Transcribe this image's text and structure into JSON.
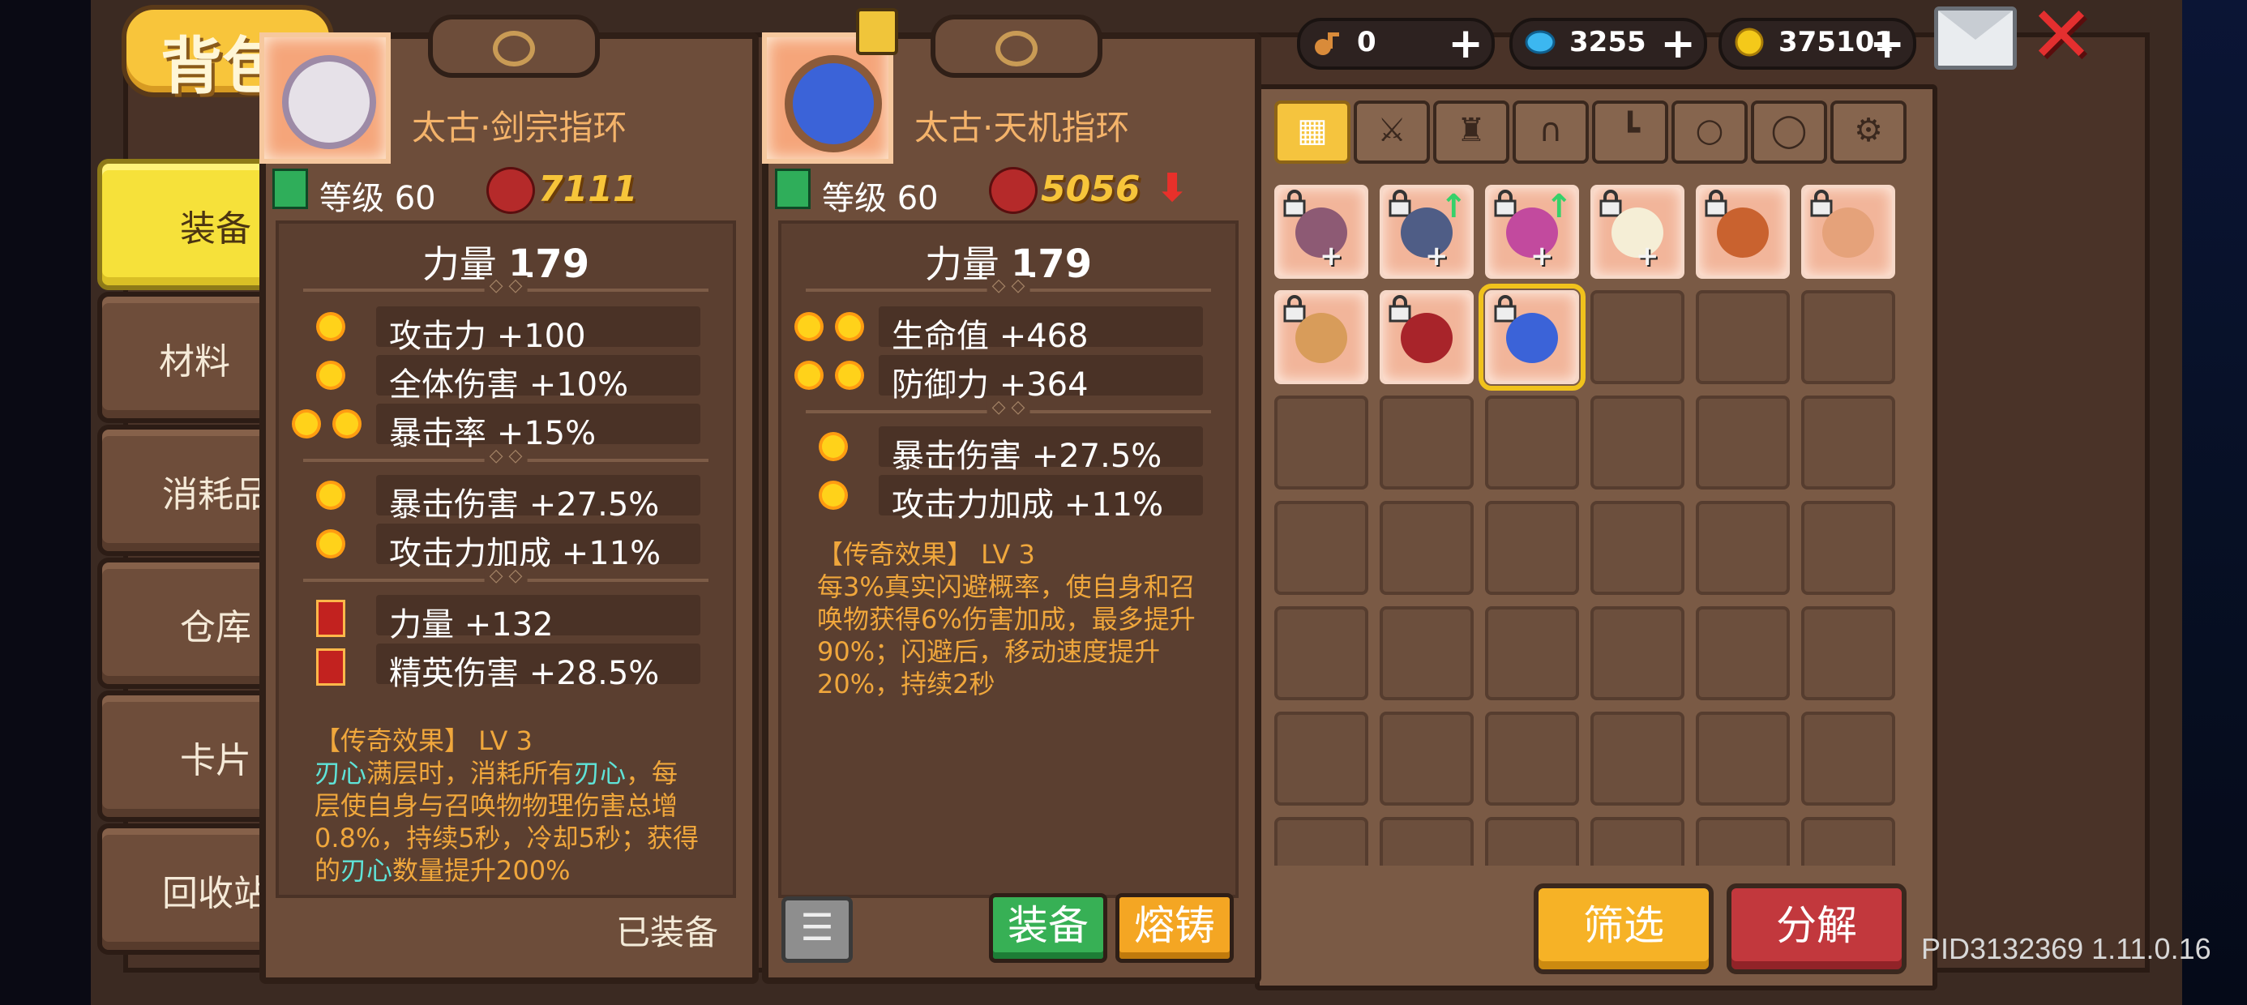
{
  "window": {
    "title": "背包",
    "close_icon": "close-x-icon",
    "mail_icon": "mail-icon"
  },
  "currencies": [
    {
      "icon": "key-icon",
      "value": "0",
      "color": "#d98b3a"
    },
    {
      "icon": "gem-icon",
      "value": "3255",
      "color": "#3cb7f0"
    },
    {
      "icon": "coin-icon",
      "value": "375101",
      "color": "#f4c91a"
    }
  ],
  "sidebar": {
    "items": [
      {
        "label": "装备",
        "active": true
      },
      {
        "label": "材料",
        "active": false
      },
      {
        "label": "消耗品",
        "active": false
      },
      {
        "label": "仓库",
        "active": false
      },
      {
        "label": "卡片",
        "active": false
      },
      {
        "label": "回收站",
        "active": false
      }
    ]
  },
  "card_left": {
    "name": "太古·剑宗指环",
    "level": "等级 60",
    "power": "7111",
    "main_stat_label": "力量",
    "main_stat_value": "179",
    "stats_a": [
      {
        "suns": 1,
        "text": "攻击力 +100"
      },
      {
        "suns": 1,
        "text": "全体伤害 +10%"
      },
      {
        "suns": 2,
        "text": "暴击率 +15%"
      }
    ],
    "stats_b": [
      {
        "suns": 1,
        "text": "暴击伤害 +27.5%"
      },
      {
        "suns": 1,
        "text": "攻击力加成 +11%"
      }
    ],
    "stats_c": [
      {
        "text": "力量 +132"
      },
      {
        "text": "精英伤害 +28.5%"
      }
    ],
    "legend_title": "【传奇效果】 LV 3",
    "legend_lines": [
      {
        "hl": "刃心",
        "rest": "满层时，消耗所有"
      },
      {
        "hl2": "刃心",
        "rest2": "，每"
      },
      {
        "line": "层使自身与召唤物物理伤害总增"
      },
      {
        "line": "0.8%，持续5秒，冷却5秒；获得"
      },
      {
        "pre": "的",
        "hl": "刃心",
        "post": "数量提升200%"
      }
    ],
    "state": "已装备"
  },
  "card_right": {
    "name": "太古·天机指环",
    "level": "等级 60",
    "power": "5056",
    "main_stat_label": "力量",
    "main_stat_value": "179",
    "stats_a": [
      {
        "suns": 2,
        "text": "生命值 +468"
      },
      {
        "suns": 2,
        "text": "防御力 +364"
      }
    ],
    "stats_b": [
      {
        "suns": 1,
        "text": "暴击伤害 +27.5%"
      },
      {
        "suns": 1,
        "text": "攻击力加成 +11%"
      }
    ],
    "legend_title": "【传奇效果】 LV 3",
    "legend_lines": [
      "每3%真实闪避概率，使自身和召",
      "唤物获得6%伤害加成，最多提升",
      "90%；闪避后，移动速度提升",
      "20%，持续2秒"
    ],
    "equip_label": "装备",
    "forge_label": "熔铸",
    "list_icon": "list-icon"
  },
  "inventory": {
    "filter_tabs": [
      "grid-icon",
      "sword-icon",
      "armor-icon",
      "helmet-icon",
      "boots-icon",
      "necklace-icon",
      "ring-icon",
      "gear-icon"
    ],
    "filter_label": "筛选",
    "decompose_label": "分解"
  },
  "version": "PID3132369 1.11.0.16"
}
